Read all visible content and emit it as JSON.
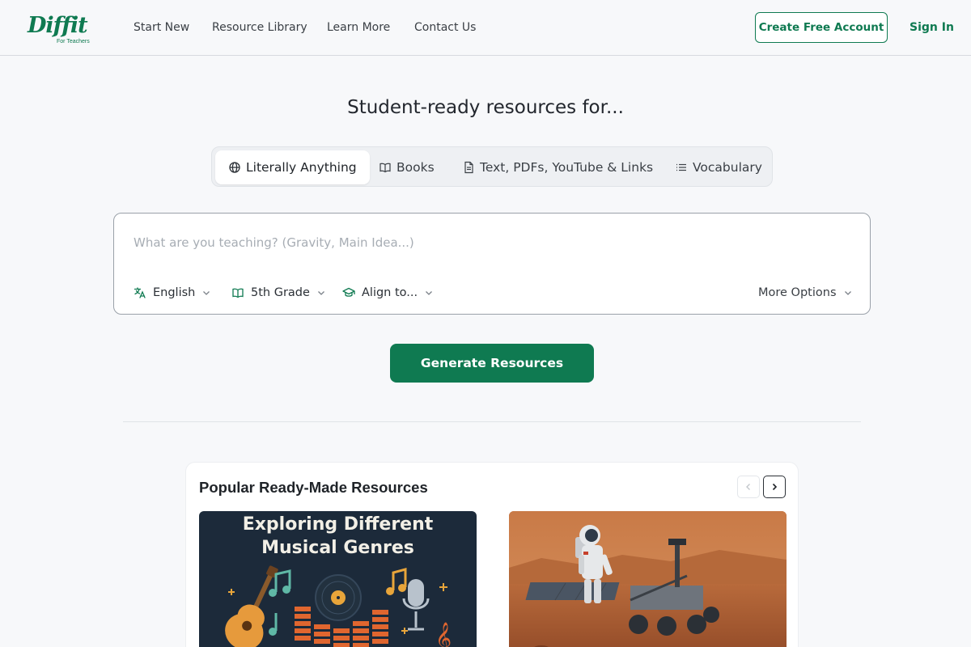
{
  "header": {
    "logo_text": "Diffit",
    "logo_sub": "For Teachers",
    "nav": [
      "Start New",
      "Resource Library",
      "Learn More",
      "Contact Us"
    ],
    "create_account_label": "Create Free Account",
    "sign_in_label": "Sign In"
  },
  "hero": {
    "title": "Student-ready resources for...",
    "tabs": [
      {
        "label": "Literally Anything",
        "icon": "globe-icon",
        "active": true
      },
      {
        "label": "Books",
        "icon": "book-icon",
        "active": false
      },
      {
        "label": "Text, PDFs, YouTube & Links",
        "icon": "file-icon",
        "active": false
      },
      {
        "label": "Vocabulary",
        "icon": "list-icon",
        "active": false
      }
    ]
  },
  "input": {
    "placeholder": "What are you teaching? (Gravity, Main Idea...)",
    "value": "",
    "options": {
      "language": "English",
      "grade": "5th Grade",
      "align": "Align to...",
      "more": "More Options"
    }
  },
  "generate_label": "Generate Resources",
  "popular": {
    "title": "Popular Ready-Made Resources",
    "cards": [
      {
        "title": "Exploring Different\nMusical Genres"
      },
      {
        "title": ""
      }
    ]
  },
  "colors": {
    "brand": "#0f7a51",
    "background": "#f7f8fa"
  }
}
